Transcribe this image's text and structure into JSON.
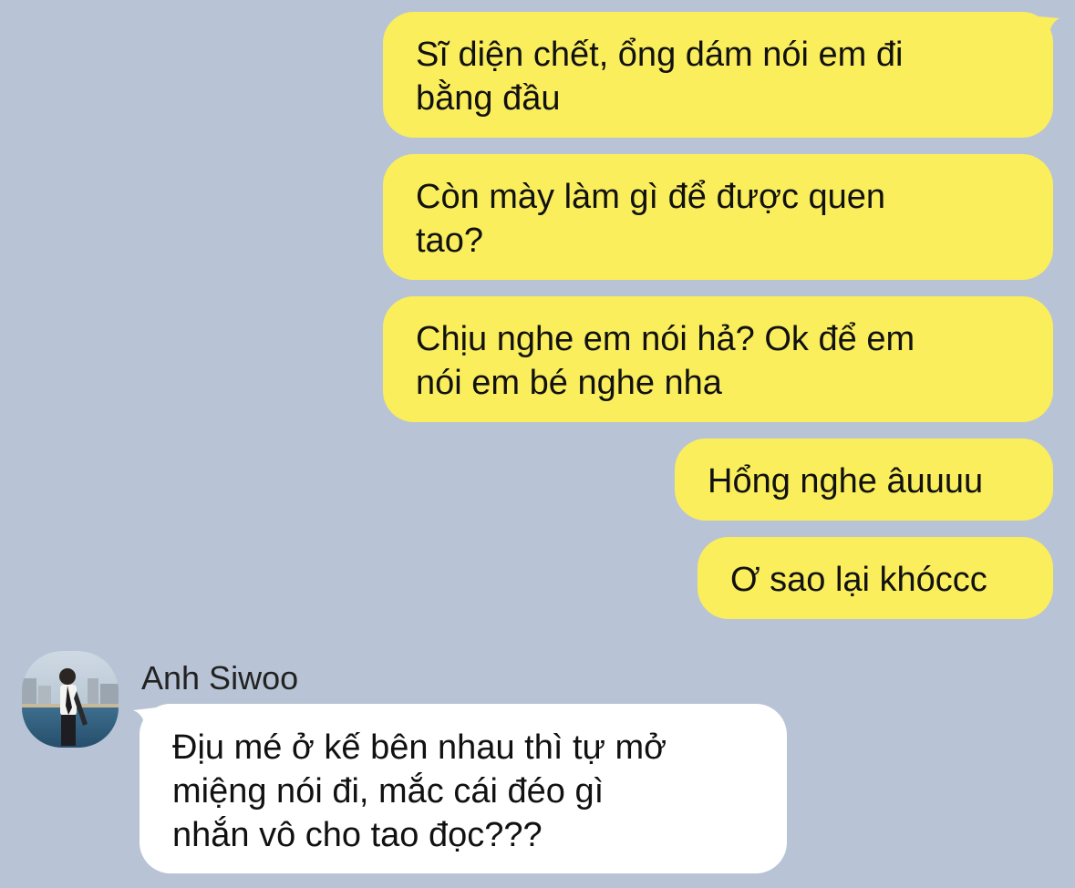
{
  "colors": {
    "background": "#b8c4d5",
    "outgoing_bubble": "#faee5c",
    "incoming_bubble": "#ffffff"
  },
  "outgoing": [
    "Sĩ diện chết, ổng dám nói em đi\nbằng đầu",
    "Còn mày làm gì để được quen\ntao?",
    "Chịu nghe em nói hả? Ok để em\nnói em bé nghe nha",
    "Hổng nghe âuuuu",
    "Ơ sao lại khóccc"
  ],
  "incoming": {
    "sender": "Anh Siwoo",
    "avatar_icon": "contact-photo-icon",
    "text": "Địu mé ở kế bên nhau thì tự mở\nmiệng nói đi, mắc cái đéo gì\nnhắn vô cho tao đọc???"
  }
}
